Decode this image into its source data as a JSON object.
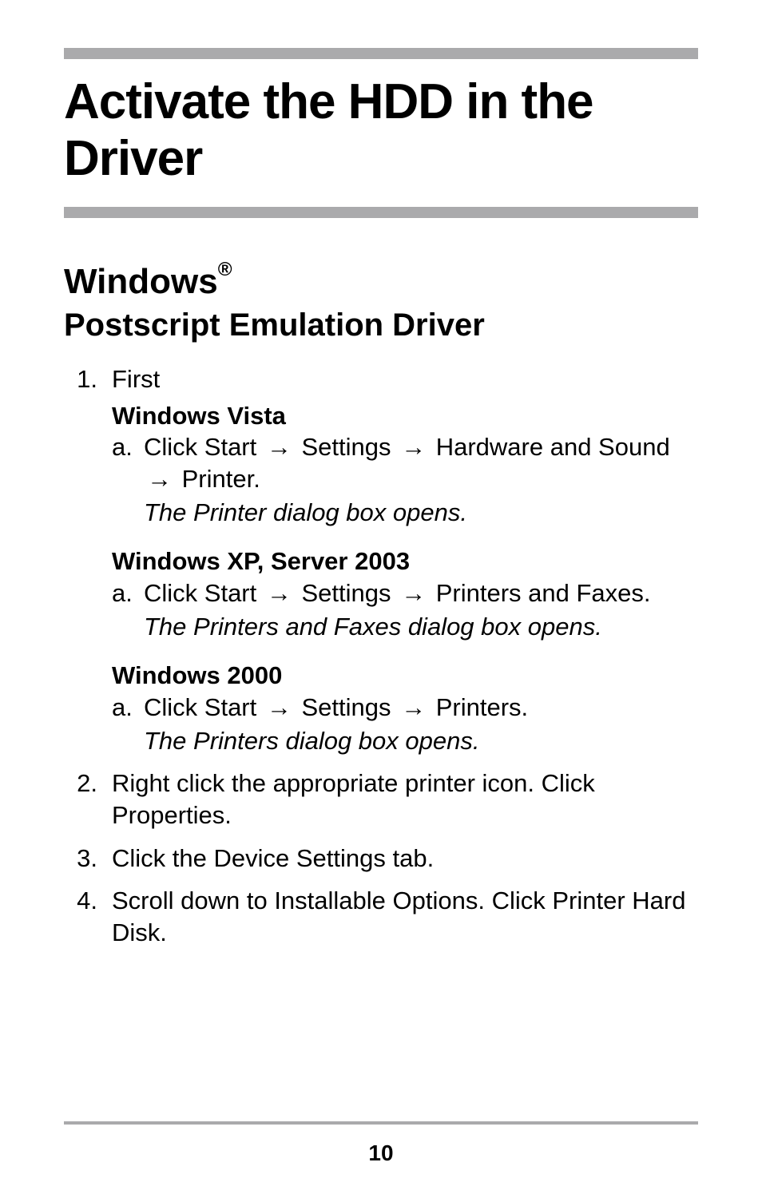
{
  "title": "Activate the HDD in the  Driver",
  "section": {
    "h1_pre": "Windows",
    "h1_sup": "®",
    "h2": "Postscript Emulation Driver"
  },
  "arrow": "→",
  "steps": {
    "n1": "1.",
    "n2": "2.",
    "n3": "3.",
    "n4": "4.",
    "s1_intro": "First",
    "vista_head": "Windows Vista",
    "a_mark": "a.",
    "vista_a_1": "Click Start ",
    "vista_a_2": "  Settings ",
    "vista_a_3": "  Hardware and Sound ",
    "vista_a_4": "  Printer.",
    "vista_italic": "The Printer dialog box opens.",
    "xp_head": "Windows XP, Server 2003",
    "xp_a_1": "Click Start ",
    "xp_a_2": "  Settings ",
    "xp_a_3": "  Printers and Faxes.",
    "xp_italic": "The Printers and Faxes dialog box opens.",
    "w2k_head": "Windows 2000",
    "w2k_a_1": "Click Start ",
    "w2k_a_2": "  Settings ",
    "w2k_a_3": "  Printers.",
    "w2k_italic": "The Printers dialog box opens.",
    "s2": "Right click the appropriate printer icon. Click Properties.",
    "s3": "Click the Device Settings tab.",
    "s4": "Scroll down to Installable Options. Click Printer Hard Disk."
  },
  "page_number": "10"
}
